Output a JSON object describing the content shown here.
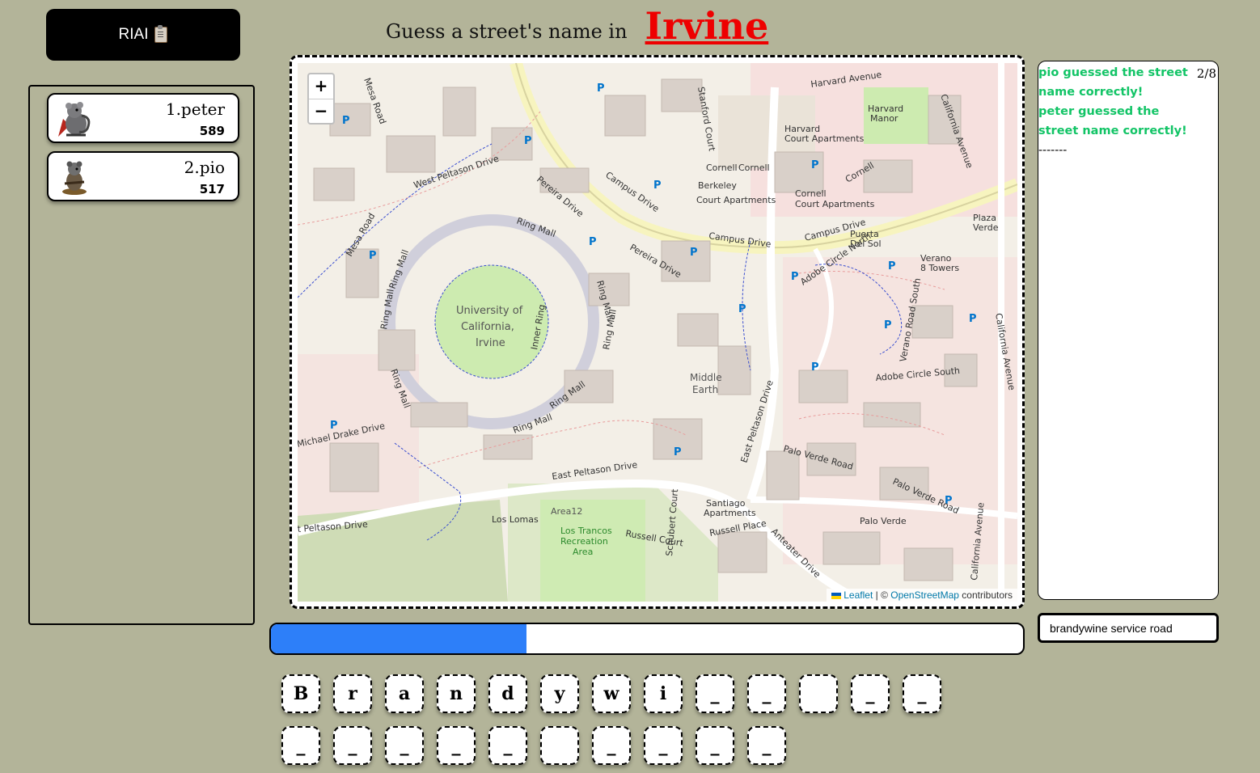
{
  "logo": {
    "label": "RIAI",
    "icon": "clipboard-icon"
  },
  "headline": {
    "lead": "Guess a street's name in",
    "city": "Irvine"
  },
  "players": [
    {
      "rank_name": "1.peter",
      "score": "589",
      "avatar": "rat-warrior-red-cape"
    },
    {
      "rank_name": "2.pio",
      "score": "517",
      "avatar": "rat-warrior-brown"
    }
  ],
  "map": {
    "zoom_in": "+",
    "zoom_out": "−",
    "attribution": {
      "leaflet": "Leaflet",
      "sep": " | © ",
      "osm": "OpenStreetMap",
      "tail": " contributors"
    },
    "labels": [
      "University of",
      "California,",
      "Irvine",
      "Ring Mall",
      "Ring Mall",
      "Ring Mall",
      "Ring Mall",
      "Ring Mall",
      "Campus Drive",
      "Campus Drive",
      "Campus Drive",
      "Campus Drive",
      "West Peltason Drive",
      "East Peltason Drive",
      "East Peltason Drive",
      "Mesa Road",
      "Mesa Road",
      "Pereira Drive",
      "Pereira Drive",
      "Harvard Avenue",
      "California Avenue",
      "California Avenue",
      "California Avenue",
      "Stanford Court",
      "Adobe Circle North",
      "Adobe Circle South",
      "Verano Road South",
      "Palo Verde Road",
      "Palo Verde Road",
      "Palo Verde",
      "Plaza Verde",
      "Middle Earth",
      "Area12",
      "Los Trancos Recreation Area",
      "Russell Court",
      "Russell Place",
      "Schubert Court",
      "Anteater Drive",
      "Santiago Apartments",
      "Los Lomas",
      "Berkeley Court Apartments",
      "Cornell Court Apartments",
      "Harvard Court Apartments",
      "Harvard Manor",
      "Cornell",
      "Cornell",
      "Cornell",
      "Michael Drake Drive",
      "Inner Ring",
      "Puerta Del Sol",
      "Verano 8 Towers"
    ]
  },
  "chat": {
    "counter": "2/8",
    "messages": [
      "pio guessed the street name correctly!",
      "peter guessed the street name correctly!"
    ],
    "separator": "-------"
  },
  "guess": {
    "value": "brandywine service road"
  },
  "progress": {
    "fraction": 0.34
  },
  "letters": {
    "row1": [
      "B",
      "r",
      "a",
      "n",
      "d",
      "y",
      "w",
      "i",
      "_",
      "_",
      "",
      "_",
      "_"
    ],
    "row2": [
      "_",
      "_",
      "_",
      "_",
      "_",
      "",
      "_",
      "_",
      "_",
      "_"
    ]
  },
  "colors": {
    "background": "#b3b499",
    "accent": "#2d7ff9",
    "city": "#ee0000",
    "chat_success": "#12c466"
  }
}
